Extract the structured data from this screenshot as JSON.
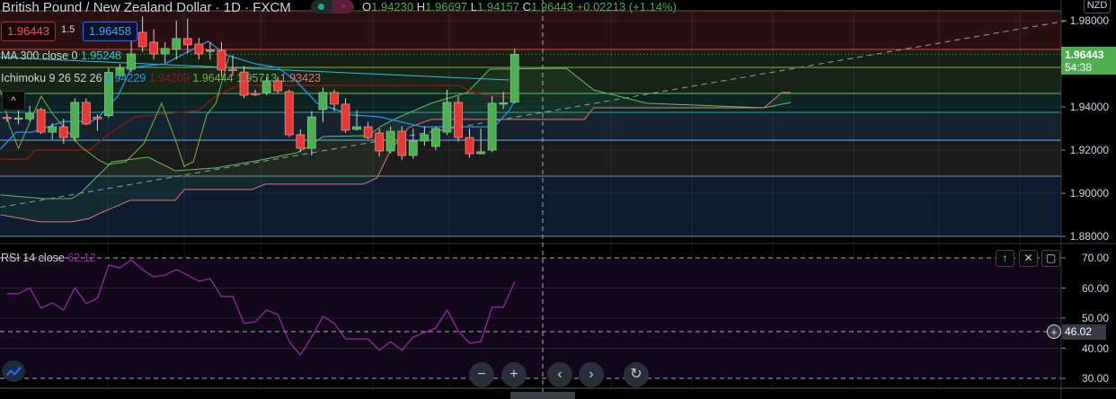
{
  "header": {
    "title": "British Pound / New Zealand Dollar · 1D · FXCM",
    "ohlc": {
      "o_label": "O",
      "o": "1.94230",
      "h_label": "H",
      "h": "1.96697",
      "l_label": "L",
      "l": "1.94157",
      "c_label": "C",
      "c": "1.96443",
      "change": "+0.02213 (+1.14%)"
    },
    "wave_icon": "≈"
  },
  "trade": {
    "sell_price": "1.96443",
    "quantity": "1.5",
    "buy_price": "1.96458"
  },
  "legends": {
    "ma": {
      "label": "MA 300 close 0",
      "value": "1.95248"
    },
    "ichimoku": {
      "label": "Ichimoku 9 26 52 26",
      "values": [
        "1.94229",
        "1.94209",
        "1.96444",
        "1.95713",
        "1.93423"
      ]
    },
    "rsi": {
      "label": "RSI 14 close",
      "value": "62.12"
    }
  },
  "price_axis": {
    "currency": "NZD",
    "ticks": [
      "1.98000",
      "1.94000",
      "1.92000",
      "1.90000",
      "1.88000"
    ],
    "current_price": "1.96443",
    "countdown": "54:38"
  },
  "rsi_axis": {
    "ticks": [
      "70.00",
      "60.00",
      "50.00",
      "40.00",
      "30.00"
    ],
    "crosshair_value": "46.02"
  },
  "controls": {
    "zoom_out": "−",
    "zoom_in": "+",
    "scroll_left": "‹",
    "scroll_right": "›",
    "reset": "↻",
    "collapse": "^",
    "pane_up": "↑",
    "pane_close": "✕",
    "pane_maximize": "▢",
    "add": "+"
  },
  "colors": {
    "up": "#4caf50",
    "down": "#e53935",
    "tenkan": "#2196f3",
    "kijun": "#8b1a1a",
    "chikou": "#7cb342",
    "span_a": "#66bb6a",
    "span_b": "#e57373",
    "ma": "#26c6da",
    "rsi": "#9c27b0"
  },
  "chart_data": [
    {
      "type": "candlestick",
      "title": "British Pound / New Zealand Dollar · 1D · FXCM",
      "ylim": [
        1.88,
        1.985
      ],
      "yticks": [
        1.98,
        1.94,
        1.92,
        1.9,
        1.88
      ],
      "candles": [
        [
          1.9352,
          1.9365,
          1.933,
          1.9348
        ],
        [
          1.9347,
          1.939,
          1.932,
          1.9349
        ],
        [
          1.9345,
          1.9405,
          1.9335,
          1.937
        ],
        [
          1.9388,
          1.9395,
          1.9275,
          1.9283
        ],
        [
          1.9283,
          1.9325,
          1.925,
          1.9308
        ],
        [
          1.9308,
          1.9345,
          1.923,
          1.9258
        ],
        [
          1.9258,
          1.944,
          1.924,
          1.9421
        ],
        [
          1.9421,
          1.944,
          1.9315,
          1.9321
        ],
        [
          1.9352,
          1.9365,
          1.929,
          1.9345
        ],
        [
          1.936,
          1.958,
          1.935,
          1.956
        ],
        [
          1.9545,
          1.96,
          1.953,
          1.958
        ],
        [
          1.9575,
          1.972,
          1.956,
          1.9646
        ],
        [
          1.9746,
          1.982,
          1.9655,
          1.9679
        ],
        [
          1.97,
          1.976,
          1.962,
          1.9646
        ],
        [
          1.9646,
          1.97,
          1.9605,
          1.9671
        ],
        [
          1.9667,
          1.98,
          1.962,
          1.9717
        ],
        [
          1.9717,
          1.981,
          1.965,
          1.9688
        ],
        [
          1.9692,
          1.972,
          1.962,
          1.9646
        ],
        [
          1.966,
          1.97,
          1.962,
          1.9664
        ],
        [
          1.9662,
          1.97,
          1.954,
          1.9571
        ],
        [
          1.9575,
          1.964,
          1.9545,
          1.9573
        ],
        [
          1.9562,
          1.959,
          1.944,
          1.9454
        ],
        [
          1.9463,
          1.948,
          1.945,
          1.9461
        ],
        [
          1.9467,
          1.954,
          1.9455,
          1.9521
        ],
        [
          1.9521,
          1.954,
          1.9462,
          1.9475
        ],
        [
          1.9471,
          1.948,
          1.926,
          1.9271
        ],
        [
          1.9271,
          1.9295,
          1.919,
          1.9208
        ],
        [
          1.9208,
          1.938,
          1.9175,
          1.9354
        ],
        [
          1.9388,
          1.949,
          1.933,
          1.9467
        ],
        [
          1.9467,
          1.948,
          1.938,
          1.9413
        ],
        [
          1.9413,
          1.944,
          1.928,
          1.9292
        ],
        [
          1.9296,
          1.9385,
          1.929,
          1.9308
        ],
        [
          1.9308,
          1.933,
          1.925,
          1.9258
        ],
        [
          1.9279,
          1.93,
          1.917,
          1.9196
        ],
        [
          1.9196,
          1.931,
          1.9185,
          1.9287
        ],
        [
          1.9287,
          1.931,
          1.9155,
          1.9175
        ],
        [
          1.9175,
          1.93,
          1.916,
          1.9242
        ],
        [
          1.9242,
          1.931,
          1.922,
          1.9271
        ],
        [
          1.9217,
          1.931,
          1.92,
          1.93
        ],
        [
          1.9283,
          1.948,
          1.927,
          1.9421
        ],
        [
          1.9421,
          1.945,
          1.924,
          1.9258
        ],
        [
          1.9258,
          1.93,
          1.9165,
          1.9183
        ],
        [
          1.9183,
          1.93,
          1.918,
          1.9192
        ],
        [
          1.92,
          1.945,
          1.919,
          1.9417
        ],
        [
          1.9417,
          1.947,
          1.939,
          1.9419
        ],
        [
          1.9423,
          1.967,
          1.9416,
          1.96443
        ]
      ],
      "levels": [
        {
          "price": 1.9846,
          "color": "#555555",
          "style": "solid"
        },
        {
          "price": 1.96667,
          "color": "#e53935",
          "style": "solid"
        },
        {
          "price": 1.96443,
          "color": "#4caf50",
          "style": "dotted"
        },
        {
          "price": 1.95833,
          "color": "#7cb342",
          "style": "solid"
        },
        {
          "price": 1.94625,
          "color": "#66bb6a",
          "style": "solid"
        },
        {
          "price": 1.9375,
          "color": "#26a69a",
          "style": "solid"
        },
        {
          "price": 1.92458,
          "color": "#64b5f6",
          "style": "solid"
        },
        {
          "price": 1.90792,
          "color": "#78909c",
          "style": "solid"
        },
        {
          "price": 1.88,
          "color": "#78909c",
          "style": "solid"
        }
      ],
      "bands": [
        {
          "from": 1.9846,
          "to": 1.96667,
          "color": "#2a1010"
        },
        {
          "from": 1.96667,
          "to": 1.95833,
          "color": "#161f14"
        },
        {
          "from": 1.95833,
          "to": 1.94625,
          "color": "#172417"
        },
        {
          "from": 1.94625,
          "to": 1.9375,
          "color": "#0b2222"
        },
        {
          "from": 1.9375,
          "to": 1.92458,
          "color": "#15222f"
        },
        {
          "from": 1.92458,
          "to": 1.90792,
          "color": "#1b1b1b"
        },
        {
          "from": 1.90792,
          "to": 1.88,
          "color": "#0b1c30"
        }
      ],
      "lines": {
        "tenkan": [
          [
            -0.6,
            1.9204
          ],
          [
            0.8,
            1.9283
          ],
          [
            2.2,
            1.9283
          ],
          [
            5,
            1.9333
          ],
          [
            7.5,
            1.9333
          ],
          [
            8.2,
            1.9358
          ],
          [
            9.8,
            1.945
          ],
          [
            10.5,
            1.9525
          ],
          [
            11,
            1.9583
          ],
          [
            14,
            1.96
          ],
          [
            17.8,
            1.9704
          ],
          [
            19.5,
            1.964
          ],
          [
            22,
            1.96
          ],
          [
            24,
            1.9583
          ],
          [
            25.6,
            1.9521
          ],
          [
            27.5,
            1.9417
          ],
          [
            30.5,
            1.9363
          ],
          [
            33,
            1.9354
          ],
          [
            36.8,
            1.9308
          ],
          [
            43.2,
            1.9308
          ],
          [
            44.5,
            1.9383
          ],
          [
            45,
            1.943
          ]
        ],
        "kijun": [
          [
            -0.6,
            1.9158
          ],
          [
            1.8,
            1.9158
          ],
          [
            2.5,
            1.92
          ],
          [
            7.3,
            1.92
          ],
          [
            8.9,
            1.9271
          ],
          [
            11.3,
            1.9354
          ],
          [
            16.9,
            1.9383
          ],
          [
            18.5,
            1.945
          ],
          [
            20.5,
            1.95
          ],
          [
            40,
            1.95
          ],
          [
            41.6,
            1.9462
          ],
          [
            45,
            1.944
          ]
        ],
        "chikou": [
          [
            -0.6,
            1.9479
          ],
          [
            0.2,
            1.9313
          ],
          [
            1,
            1.9208
          ],
          [
            3,
            1.945
          ],
          [
            4.1,
            1.9363
          ],
          [
            6.5,
            1.9217
          ],
          [
            8.1,
            1.9154
          ],
          [
            8.9,
            1.9133
          ],
          [
            10.5,
            1.9146
          ],
          [
            12.1,
            1.9229
          ],
          [
            13.7,
            1.9417
          ],
          [
            14.9,
            1.925
          ],
          [
            15.7,
            1.9125
          ],
          [
            16.5,
            1.9146
          ],
          [
            17.7,
            1.9363
          ],
          [
            18.5,
            1.9417
          ],
          [
            19.7,
            1.9638
          ]
        ],
        "span_a": [
          [
            -0.6,
            1.8992
          ],
          [
            3.3,
            1.8975
          ],
          [
            5.7,
            1.8975
          ],
          [
            6.5,
            1.9
          ],
          [
            7.7,
            1.9063
          ],
          [
            9.3,
            1.9146
          ],
          [
            12.5,
            1.9167
          ],
          [
            14.9,
            1.9104
          ],
          [
            18.5,
            1.9117
          ],
          [
            22.5,
            1.9154
          ],
          [
            25.7,
            1.9188
          ],
          [
            26.9,
            1.9221
          ],
          [
            28,
            1.9263
          ],
          [
            32,
            1.9267
          ],
          [
            33.2,
            1.9313
          ],
          [
            34.8,
            1.9354
          ],
          [
            37.6,
            1.9417
          ],
          [
            40.8,
            1.9467
          ],
          [
            42.8,
            1.9575
          ],
          [
            49.6,
            1.9579
          ],
          [
            52,
            1.9479
          ],
          [
            56.7,
            1.9417
          ],
          [
            67.1,
            1.9396
          ],
          [
            69.5,
            1.9421
          ]
        ],
        "span_b": [
          [
            -0.6,
            1.89
          ],
          [
            2.9,
            1.8867
          ],
          [
            5.7,
            1.8867
          ],
          [
            7.3,
            1.8883
          ],
          [
            8.1,
            1.8904
          ],
          [
            10.9,
            1.8967
          ],
          [
            14.9,
            1.8967
          ],
          [
            15.7,
            1.9017
          ],
          [
            21.7,
            1.9017
          ],
          [
            22.9,
            1.9042
          ],
          [
            31.6,
            1.9042
          ],
          [
            32.8,
            1.9071
          ],
          [
            34,
            1.92
          ],
          [
            35.6,
            1.9304
          ],
          [
            37.6,
            1.9342
          ],
          [
            51.2,
            1.9342
          ],
          [
            52,
            1.9396
          ],
          [
            67.1,
            1.9396
          ],
          [
            68.7,
            1.9467
          ],
          [
            69.5,
            1.9467
          ]
        ],
        "ma300": [
          [
            -0.6,
            1.963
          ],
          [
            44.5,
            1.9525
          ]
        ],
        "trendline": [
          [
            -0.6,
            1.8935
          ],
          [
            94,
            1.98
          ]
        ]
      }
    },
    {
      "type": "line",
      "title": "RSI 14 close",
      "ylim": [
        30,
        70
      ],
      "yticks": [
        70,
        60,
        50,
        40,
        30
      ],
      "values": [
        58.1,
        58.1,
        60.1,
        53.3,
        55.1,
        52.7,
        60.1,
        54.8,
        56.6,
        67.6,
        66.7,
        69.4,
        66.1,
        63.7,
        64.3,
        66.1,
        64.3,
        62.2,
        63.1,
        57.2,
        57.2,
        48.2,
        48.8,
        52.7,
        51.2,
        42.2,
        37.8,
        43.7,
        50.6,
        48.2,
        43.1,
        43.1,
        43.1,
        39.3,
        42.2,
        39.3,
        43.7,
        45.2,
        46.7,
        52.7,
        45.8,
        41.6,
        42.2,
        53.6,
        53.6,
        62.12
      ]
    }
  ]
}
